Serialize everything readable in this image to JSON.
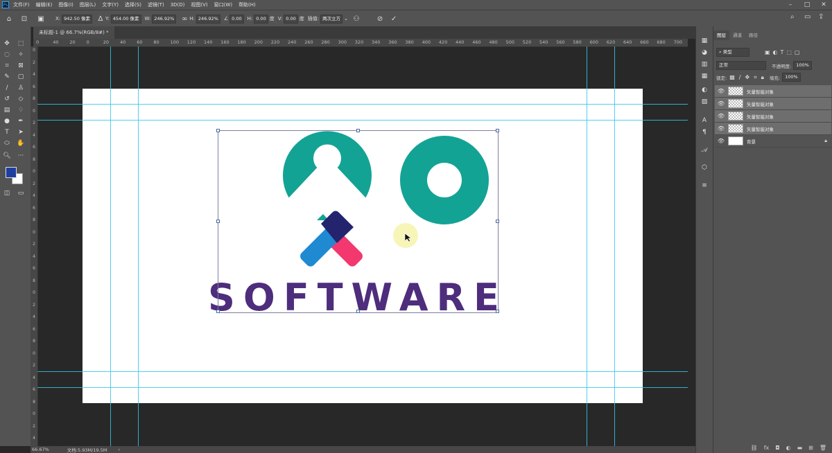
{
  "app": {
    "logo": "Ps"
  },
  "menu": [
    "文件(F)",
    "编辑(E)",
    "图像(I)",
    "图层(L)",
    "文字(Y)",
    "选择(S)",
    "滤镜(T)",
    "3D(D)",
    "视图(V)",
    "窗口(W)",
    "帮助(H)"
  ],
  "options": {
    "x_label": "X:",
    "x_value": "942.50 像素",
    "y_label": "Y:",
    "y_value": "454.00 像素",
    "w_label": "W:",
    "w_value": "246.92%",
    "h_label": "H:",
    "h_value": "246.92%",
    "angle_value": "0.00",
    "hskew_label": "H:",
    "hskew_value": "0.00",
    "hskew_unit": "度",
    "vskew_label": "V:",
    "vskew_value": "0.00",
    "vskew_unit": "度",
    "interp_label": "插值:",
    "interp_value": "两次立方"
  },
  "document": {
    "tab_title": "未标题-1 @ 66.7%(RGB/8#) *"
  },
  "ruler": {
    "h_ticks": [
      "0",
      "40",
      "20",
      "0",
      "20",
      "40",
      "60",
      "80",
      "100",
      "120",
      "140",
      "160",
      "180",
      "200",
      "220",
      "240",
      "260",
      "280",
      "300",
      "320",
      "340",
      "360",
      "380",
      "400",
      "420",
      "440",
      "460",
      "480",
      "500",
      "520",
      "540",
      "560",
      "580",
      "600",
      "620",
      "640",
      "660",
      "680",
      "700",
      "720"
    ],
    "v_ticks": [
      "0",
      "2",
      "4",
      "6",
      "8",
      "0",
      "2",
      "4",
      "6",
      "8",
      "0",
      "2",
      "4",
      "6",
      "8",
      "0",
      "2",
      "4",
      "6",
      "8",
      "0",
      "2",
      "4",
      "6",
      "8",
      "0",
      "2",
      "4",
      "6",
      "8",
      "0",
      "2",
      "4"
    ]
  },
  "canvas_art": {
    "word": "SOFTWARE",
    "teal": "#13a395",
    "purple": "#4d2d7c",
    "navy": "#24246e",
    "blue": "#1f89d2",
    "pink": "#f2386e"
  },
  "status": {
    "zoom": "66.67%",
    "doc": "文档:5.93M/19.5M"
  },
  "panel": {
    "tabs": [
      "图层",
      "通道",
      "路径"
    ],
    "search_placeholder": "类型",
    "blend_mode": "正常",
    "opacity_label": "不透明度:",
    "opacity_value": "100%",
    "lock_label": "锁定:",
    "fill_label": "填充:",
    "fill_value": "100%",
    "layers": [
      {
        "name": "矢量智能对象",
        "selected": true
      },
      {
        "name": "矢量智能对象",
        "selected": true
      },
      {
        "name": "矢量智能对象",
        "selected": true
      },
      {
        "name": "矢量智能对象",
        "selected": true
      },
      {
        "name": "背景",
        "selected": false
      }
    ]
  },
  "colors": {
    "foreground": "#1e3fa0",
    "background": "#ffffff",
    "guide": "#35c7ea"
  }
}
